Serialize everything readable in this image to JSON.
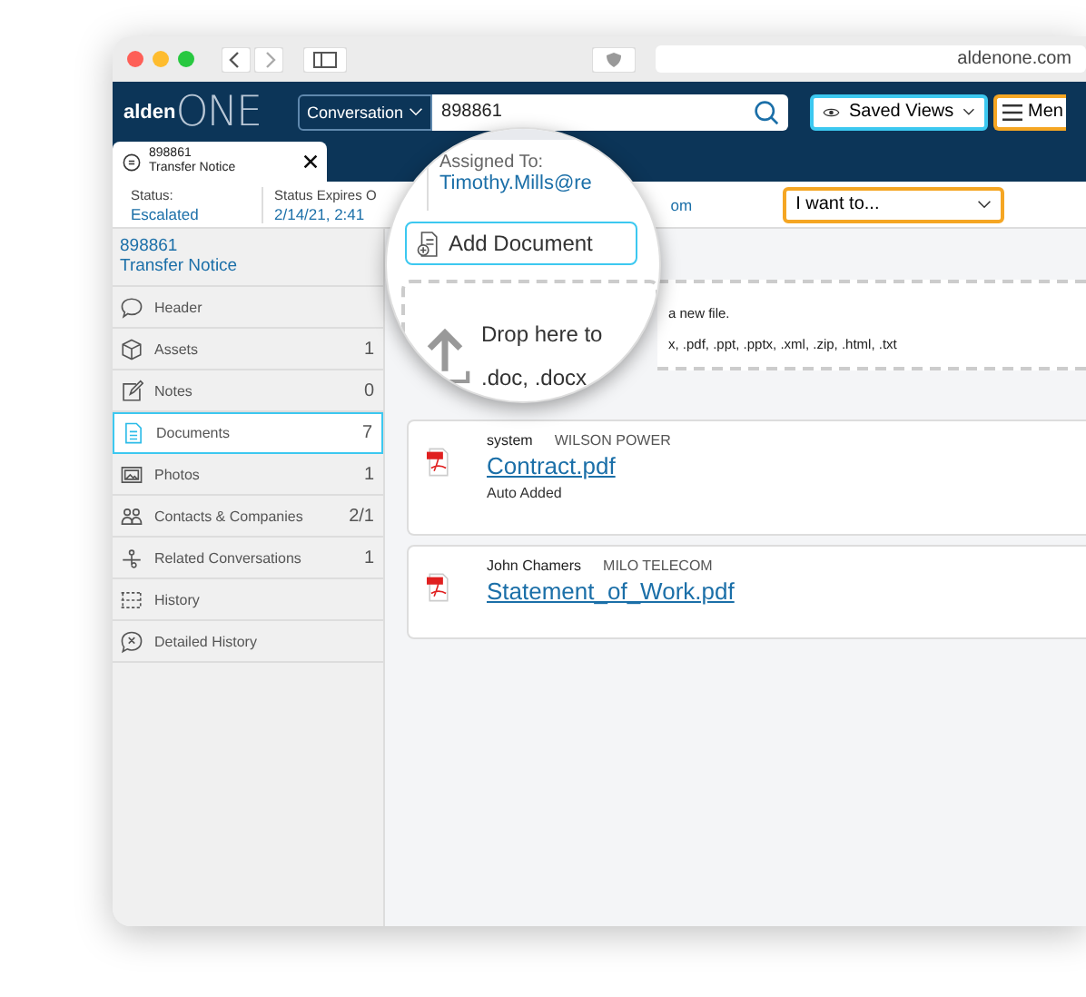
{
  "browser": {
    "url": "aldenone.com"
  },
  "header": {
    "logo_left": "alden",
    "logo_right": "ONE",
    "search_scope": "Conversation",
    "search_value": "898861",
    "saved_views": "Saved Views",
    "menu": "Men"
  },
  "tab": {
    "number": "898861",
    "title": "Transfer Notice"
  },
  "status": [
    {
      "label": "Status:",
      "value": "Escalated"
    },
    {
      "label": "Status Expires O",
      "value": "2/14/21, 2:41"
    }
  ],
  "assigned": {
    "label": "Assigned To:",
    "value": "Timothy.Mills@re",
    "tail": "om"
  },
  "action_select": "I want to...",
  "sidebar": {
    "number": "898861",
    "title": "Transfer Notice",
    "items": [
      {
        "label": "Header",
        "selected": false
      },
      {
        "label": "Assets",
        "count": "1",
        "selected": false
      },
      {
        "label": "Notes",
        "count": "0",
        "selected": false
      },
      {
        "label": "Documents",
        "count": "7",
        "selected": true
      },
      {
        "label": "Photos",
        "count": "1",
        "selected": false
      },
      {
        "label": "Contacts & Companies",
        "count": "2/1",
        "selected": false
      },
      {
        "label": "Related Conversations",
        "count": "1",
        "selected": false
      },
      {
        "label": "History",
        "selected": false
      },
      {
        "label": "Detailed History",
        "selected": false
      }
    ]
  },
  "add_button": "Add Document",
  "dropzone": {
    "title": "Drop here to",
    "title_tail": "a new file.",
    "types": ".doc, .docx",
    "types_tail": "x, .pdf, .ppt, .pptx, .xml, .zip, .html, .txt"
  },
  "documents": [
    {
      "author": "system",
      "company": "WILSON POWER",
      "file": "Contract.pdf",
      "note": "Auto Added"
    },
    {
      "author": "John Chamers",
      "company": "MILO TELECOM",
      "file": "Statement_of_Work.pdf"
    }
  ]
}
